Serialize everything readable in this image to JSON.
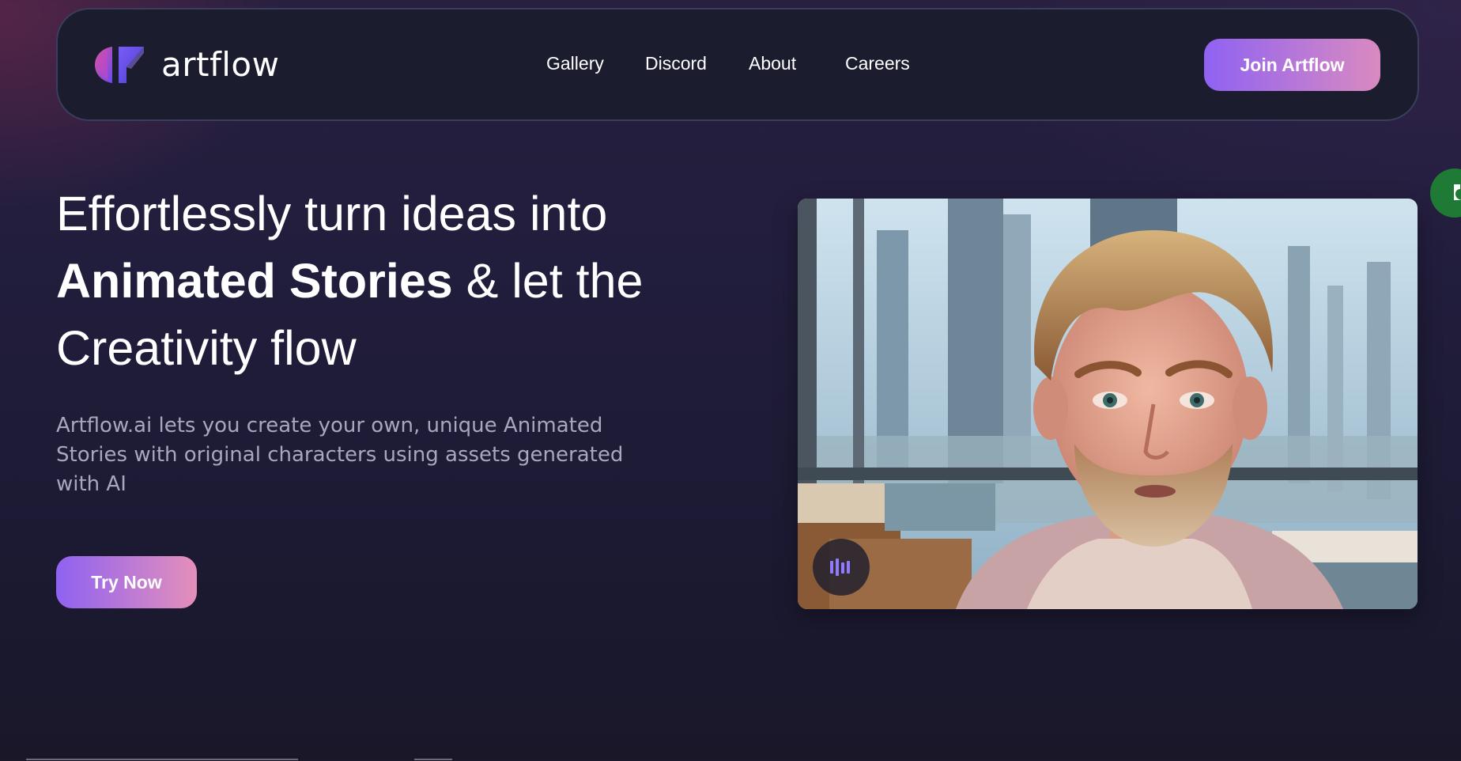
{
  "nav": {
    "logo_text": "artflow",
    "links": [
      {
        "label": "Gallery"
      },
      {
        "label": "Discord"
      },
      {
        "label": "About"
      },
      {
        "label": "Careers"
      }
    ],
    "cta_label": "Join Artflow"
  },
  "hero": {
    "headline_line1": "Effortlessly turn ideas into",
    "headline_strong": "Animated Stories",
    "headline_line2_rest": " & let the",
    "headline_line3": "Creativity flow",
    "subtext": "Artflow.ai lets you create your own, unique Animated Stories with original characters using assets generated with AI",
    "cta_label": "Try Now"
  },
  "video": {
    "audio_icon": "audio-bars-icon"
  },
  "colors": {
    "accent_start": "#8f62f2",
    "accent_end": "#e48fba",
    "background": "#211d3c",
    "nav_bg": "#1b1c2e",
    "widget_green": "#1f7a35"
  }
}
